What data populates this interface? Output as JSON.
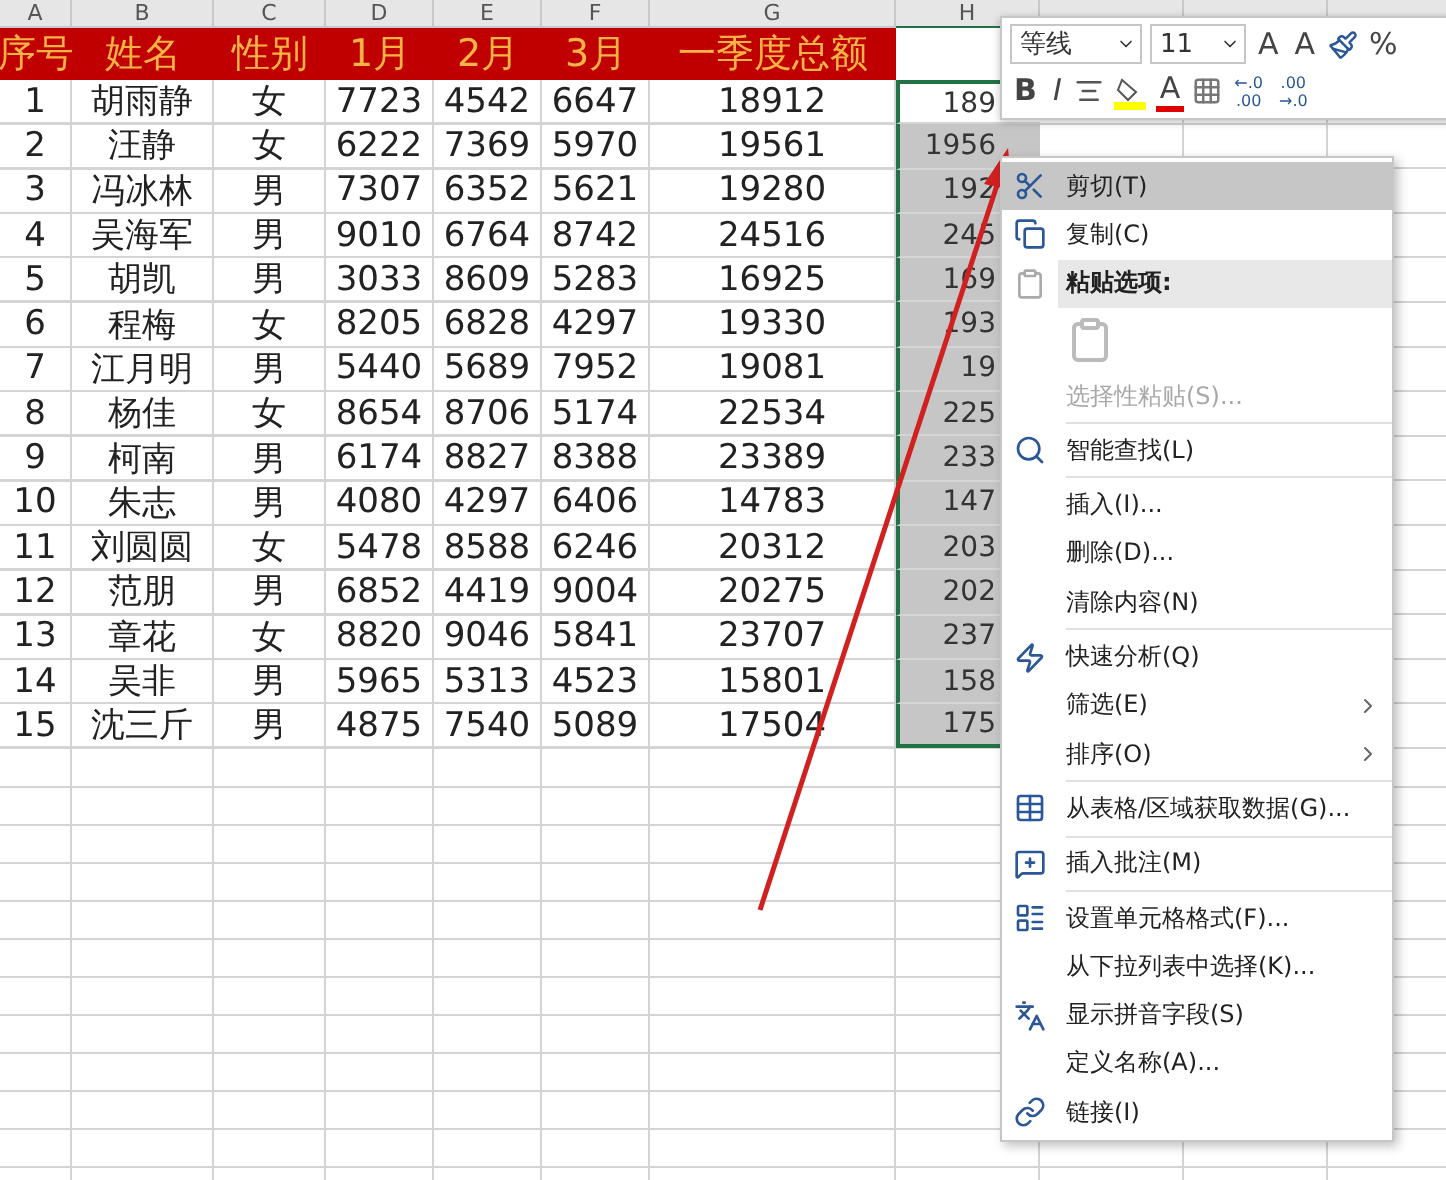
{
  "columns": [
    "A",
    "B",
    "C",
    "D",
    "E",
    "F",
    "G",
    "H"
  ],
  "header": [
    "序号",
    "姓名",
    "性别",
    "1月",
    "2月",
    "3月",
    "一季度总额"
  ],
  "rows": [
    {
      "cells": [
        "1",
        "胡雨静",
        "女",
        "7723",
        "4542",
        "6647",
        "18912"
      ],
      "h": "189",
      "active": true
    },
    {
      "cells": [
        "2",
        "汪静",
        "女",
        "6222",
        "7369",
        "5970",
        "19561"
      ],
      "h": "1956",
      "active": false
    },
    {
      "cells": [
        "3",
        "冯冰林",
        "男",
        "7307",
        "6352",
        "5621",
        "19280"
      ],
      "h": "192",
      "active": false
    },
    {
      "cells": [
        "4",
        "吴海军",
        "男",
        "9010",
        "6764",
        "8742",
        "24516"
      ],
      "h": "245",
      "active": false
    },
    {
      "cells": [
        "5",
        "胡凯",
        "男",
        "3033",
        "8609",
        "5283",
        "16925"
      ],
      "h": "169",
      "active": false
    },
    {
      "cells": [
        "6",
        "程梅",
        "女",
        "8205",
        "6828",
        "4297",
        "19330"
      ],
      "h": "193",
      "active": false
    },
    {
      "cells": [
        "7",
        "江月明",
        "男",
        "5440",
        "5689",
        "7952",
        "19081"
      ],
      "h": "19",
      "active": false
    },
    {
      "cells": [
        "8",
        "杨佳",
        "女",
        "8654",
        "8706",
        "5174",
        "22534"
      ],
      "h": "225",
      "active": false
    },
    {
      "cells": [
        "9",
        "柯南",
        "男",
        "6174",
        "8827",
        "8388",
        "23389"
      ],
      "h": "233",
      "active": false
    },
    {
      "cells": [
        "10",
        "朱志",
        "男",
        "4080",
        "4297",
        "6406",
        "14783"
      ],
      "h": "147",
      "active": false
    },
    {
      "cells": [
        "11",
        "刘圆圆",
        "女",
        "5478",
        "8588",
        "6246",
        "20312"
      ],
      "h": "203",
      "active": false
    },
    {
      "cells": [
        "12",
        "范朋",
        "男",
        "6852",
        "4419",
        "9004",
        "20275"
      ],
      "h": "202",
      "active": false
    },
    {
      "cells": [
        "13",
        "章花",
        "女",
        "8820",
        "9046",
        "5841",
        "23707"
      ],
      "h": "237",
      "active": false
    },
    {
      "cells": [
        "14",
        "吴非",
        "男",
        "5965",
        "5313",
        "4523",
        "15801"
      ],
      "h": "158",
      "active": false
    },
    {
      "cells": [
        "15",
        "沈三斤",
        "男",
        "4875",
        "7540",
        "5089",
        "17504"
      ],
      "h": "175",
      "active": false
    }
  ],
  "mini_toolbar": {
    "font": "等线",
    "size": "11",
    "row_1": [
      {
        "kind": "grow",
        "label": "A"
      },
      {
        "kind": "shrink",
        "label": "A"
      },
      {
        "kind": "format"
      },
      {
        "kind": "percent",
        "label": "%"
      }
    ],
    "row_2": [
      {
        "kind": "bold",
        "label": "B"
      },
      {
        "kind": "italic",
        "label": "I"
      },
      {
        "kind": "align"
      },
      {
        "kind": "fill"
      },
      {
        "kind": "font_color",
        "label": "A"
      },
      {
        "kind": "borders"
      },
      {
        "kind": "inc_decimal",
        "lines": [
          "←.0",
          ".00"
        ]
      },
      {
        "kind": "dec_decimal",
        "lines": [
          ".00",
          "→.0"
        ]
      }
    ]
  },
  "context_menu": {
    "groups": [
      [
        {
          "kind": "item",
          "label": "剪切(T)",
          "selected": true,
          "disabled": false,
          "submenu": false
        },
        {
          "kind": "item",
          "label": "复制(C)",
          "selected": false,
          "disabled": false,
          "submenu": false
        },
        {
          "kind": "header",
          "label": "粘贴选项:",
          "selected": false,
          "disabled": false,
          "submenu": false
        },
        {
          "kind": "paste",
          "selected": false,
          "disabled": false,
          "submenu": false
        },
        {
          "kind": "item",
          "label": "选择性粘贴(S)...",
          "selected": false,
          "disabled": true,
          "submenu": false
        }
      ],
      [
        {
          "kind": "item",
          "label": "智能查找(L)",
          "selected": false,
          "disabled": false,
          "submenu": false
        }
      ],
      [
        {
          "kind": "item",
          "label": "插入(I)...",
          "selected": false,
          "disabled": false,
          "submenu": false
        },
        {
          "kind": "item",
          "label": "删除(D)...",
          "selected": false,
          "disabled": false,
          "submenu": false
        },
        {
          "kind": "item",
          "label": "清除内容(N)",
          "selected": false,
          "disabled": false,
          "submenu": false
        }
      ],
      [
        {
          "kind": "item",
          "label": "快速分析(Q)",
          "selected": false,
          "disabled": false,
          "submenu": false
        },
        {
          "kind": "item",
          "label": "筛选(E)",
          "selected": false,
          "disabled": false,
          "submenu": true
        },
        {
          "kind": "item",
          "label": "排序(O)",
          "selected": false,
          "disabled": false,
          "submenu": true
        }
      ],
      [
        {
          "kind": "item",
          "label": "从表格/区域获取数据(G)...",
          "selected": false,
          "disabled": false,
          "submenu": false
        }
      ],
      [
        {
          "kind": "item",
          "label": "插入批注(M)",
          "selected": false,
          "disabled": false,
          "submenu": false
        }
      ],
      [
        {
          "kind": "item",
          "label": "设置单元格格式(F)...",
          "selected": false,
          "disabled": false,
          "submenu": false
        },
        {
          "kind": "item",
          "label": "从下拉列表中选择(K)...",
          "selected": false,
          "disabled": false,
          "submenu": false
        },
        {
          "kind": "item",
          "label": "显示拼音字段(S)",
          "selected": false,
          "disabled": false,
          "submenu": false
        },
        {
          "kind": "item",
          "label": "定义名称(A)...",
          "selected": false,
          "disabled": false,
          "submenu": false
        },
        {
          "kind": "item",
          "label": "链接(I)",
          "selected": false,
          "disabled": false,
          "submenu": false
        }
      ]
    ]
  }
}
